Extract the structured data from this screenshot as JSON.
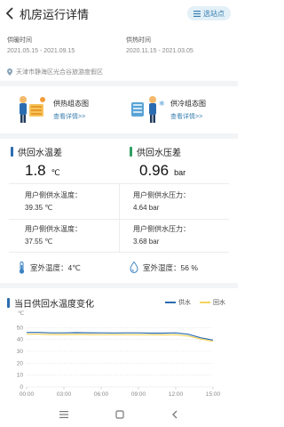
{
  "header": {
    "title": "机房运行详情",
    "chip_label": "选站点"
  },
  "periods": [
    {
      "label": "供暖时间",
      "range": "2021.05.15 - 2021.09.15"
    },
    {
      "label": "供热时间",
      "range": "2020.11.15 - 2021.03.05"
    }
  ],
  "location": "天津市静海区光合谷旅游度假区",
  "cards": [
    {
      "title": "供热组态图",
      "link": "查看详情>>"
    },
    {
      "title": "供冷组态图",
      "link": "查看详情>>"
    }
  ],
  "metrics": {
    "temp": {
      "title": "供回水温差",
      "value": "1.8",
      "unit": "℃",
      "supply_label": "用户侧供水温度：",
      "supply_value": "39.35 ℃",
      "return_label": "用户侧供水温度：",
      "return_value": "37.55 ℃"
    },
    "pressure": {
      "title": "供回水压差",
      "value": "0.96",
      "unit": "bar",
      "supply_label": "用户侧供水压力：",
      "supply_value": "4.64 bar",
      "return_label": "用户侧供水压力：",
      "return_value": "3.68 bar"
    }
  },
  "outdoor": {
    "temp_text": "室外温度：4℃",
    "humidity_text": "室外湿度：56 %"
  },
  "colors": {
    "accent": "#2b6cb0",
    "green": "#2f9e63",
    "supply_line": "#2b6cb0",
    "return_line": "#f2d35b"
  },
  "chart_data": {
    "type": "line",
    "title": "当日供回水温度变化",
    "ylabel": "℃",
    "x": [
      "00:00",
      "03:00",
      "06:00",
      "09:00",
      "12:00",
      "15:00"
    ],
    "ylim": [
      0,
      60
    ],
    "yticks": [
      0,
      10,
      20,
      30,
      40,
      50
    ],
    "grid": true,
    "legend_position": "top-right",
    "series": [
      {
        "name": "供水",
        "points": [
          [
            0,
            46
          ],
          [
            1,
            46
          ],
          [
            2,
            45.6
          ],
          [
            3,
            45.6
          ],
          [
            4,
            45.8
          ],
          [
            5,
            45.7
          ],
          [
            6,
            45.6
          ],
          [
            7,
            45.5
          ],
          [
            8,
            45.6
          ],
          [
            9,
            45.6
          ],
          [
            10,
            45.4
          ],
          [
            11,
            45.4
          ],
          [
            12,
            45.6
          ],
          [
            13,
            44.5
          ],
          [
            14,
            41.5
          ],
          [
            15,
            39.5
          ]
        ]
      },
      {
        "name": "回水",
        "points": [
          [
            0,
            44.5
          ],
          [
            1,
            44.5
          ],
          [
            2,
            44.2
          ],
          [
            3,
            44.2
          ],
          [
            4,
            44.3
          ],
          [
            5,
            44.2
          ],
          [
            6,
            44.1
          ],
          [
            7,
            44.1
          ],
          [
            8,
            44.1
          ],
          [
            9,
            44.0
          ],
          [
            10,
            44.0
          ],
          [
            11,
            43.9
          ],
          [
            12,
            44.0
          ],
          [
            13,
            43.0
          ],
          [
            14,
            40.5
          ],
          [
            15,
            38.5
          ]
        ]
      }
    ]
  }
}
